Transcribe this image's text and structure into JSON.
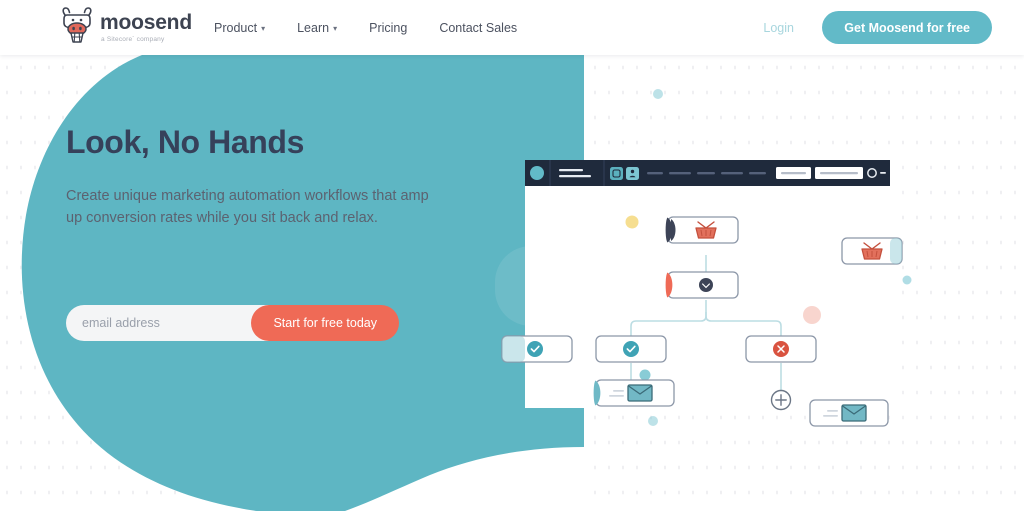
{
  "header": {
    "logo": {
      "icon": "moosend-cow-logo-icon",
      "wordmark": "moosend",
      "tagline": "a Sitecore´ company"
    },
    "nav_items": [
      {
        "label": "Product",
        "has_caret": true,
        "caret": "▾"
      },
      {
        "label": "Learn",
        "has_caret": true,
        "caret": "▾"
      },
      {
        "label": "Pricing",
        "has_caret": false,
        "caret": ""
      },
      {
        "label": "Contact Sales",
        "has_caret": false,
        "caret": ""
      }
    ],
    "login_label": "Login",
    "cta_label": "Get Moosend for free"
  },
  "hero": {
    "title": "Look, No Hands",
    "subtitle": "Create unique marketing automation workflows that amp up conversion rates while you sit back and relax.",
    "form": {
      "email_placeholder": "email address",
      "email_value": "",
      "submit_label": "Start for free today"
    }
  },
  "illustration": {
    "name": "automation-workflow-illustration",
    "app_window": {
      "toolbar": {
        "avatar": "user-avatar-circle",
        "tool_icons": [
          "square-tool-icon",
          "person-tool-icon"
        ],
        "menu_placeholder_count": 5,
        "button_placeholder_count": 2,
        "right_icons": [
          "circle-icon",
          "dash-icon"
        ]
      },
      "nodes": [
        {
          "id": "node-cart-trigger",
          "icon": "shopping-cart-icon",
          "accent": "#3d4457",
          "label": ""
        },
        {
          "id": "node-delay",
          "icon": "clock-icon",
          "accent": "#ef6a56",
          "label": ""
        },
        {
          "id": "node-condition-yes",
          "icon": "check-circle-icon",
          "accent": "",
          "label": ""
        },
        {
          "id": "node-condition-no",
          "icon": "x-circle-icon",
          "accent": "",
          "label": ""
        },
        {
          "id": "node-email-left",
          "icon": "envelope-icon",
          "accent": "#4f9fae",
          "label": ""
        },
        {
          "id": "node-email-right",
          "icon": "envelope-icon",
          "accent": "",
          "label": ""
        },
        {
          "id": "node-cart-offscreen",
          "icon": "shopping-cart-icon",
          "accent": "",
          "label": ""
        },
        {
          "id": "node-check-offscreen",
          "icon": "check-circle-icon",
          "accent": "",
          "label": ""
        }
      ],
      "add_button": "plus-circle-button"
    }
  },
  "colors": {
    "teal": "#62bac8",
    "teal_blob": "#5eb6c3",
    "coral": "#ef6a56",
    "navy": "#36415a",
    "toolbar_navy": "#1f2a3c",
    "body_text": "#5c6270",
    "login_text": "#a8d6de",
    "yellow_dot": "#f5d87c"
  }
}
